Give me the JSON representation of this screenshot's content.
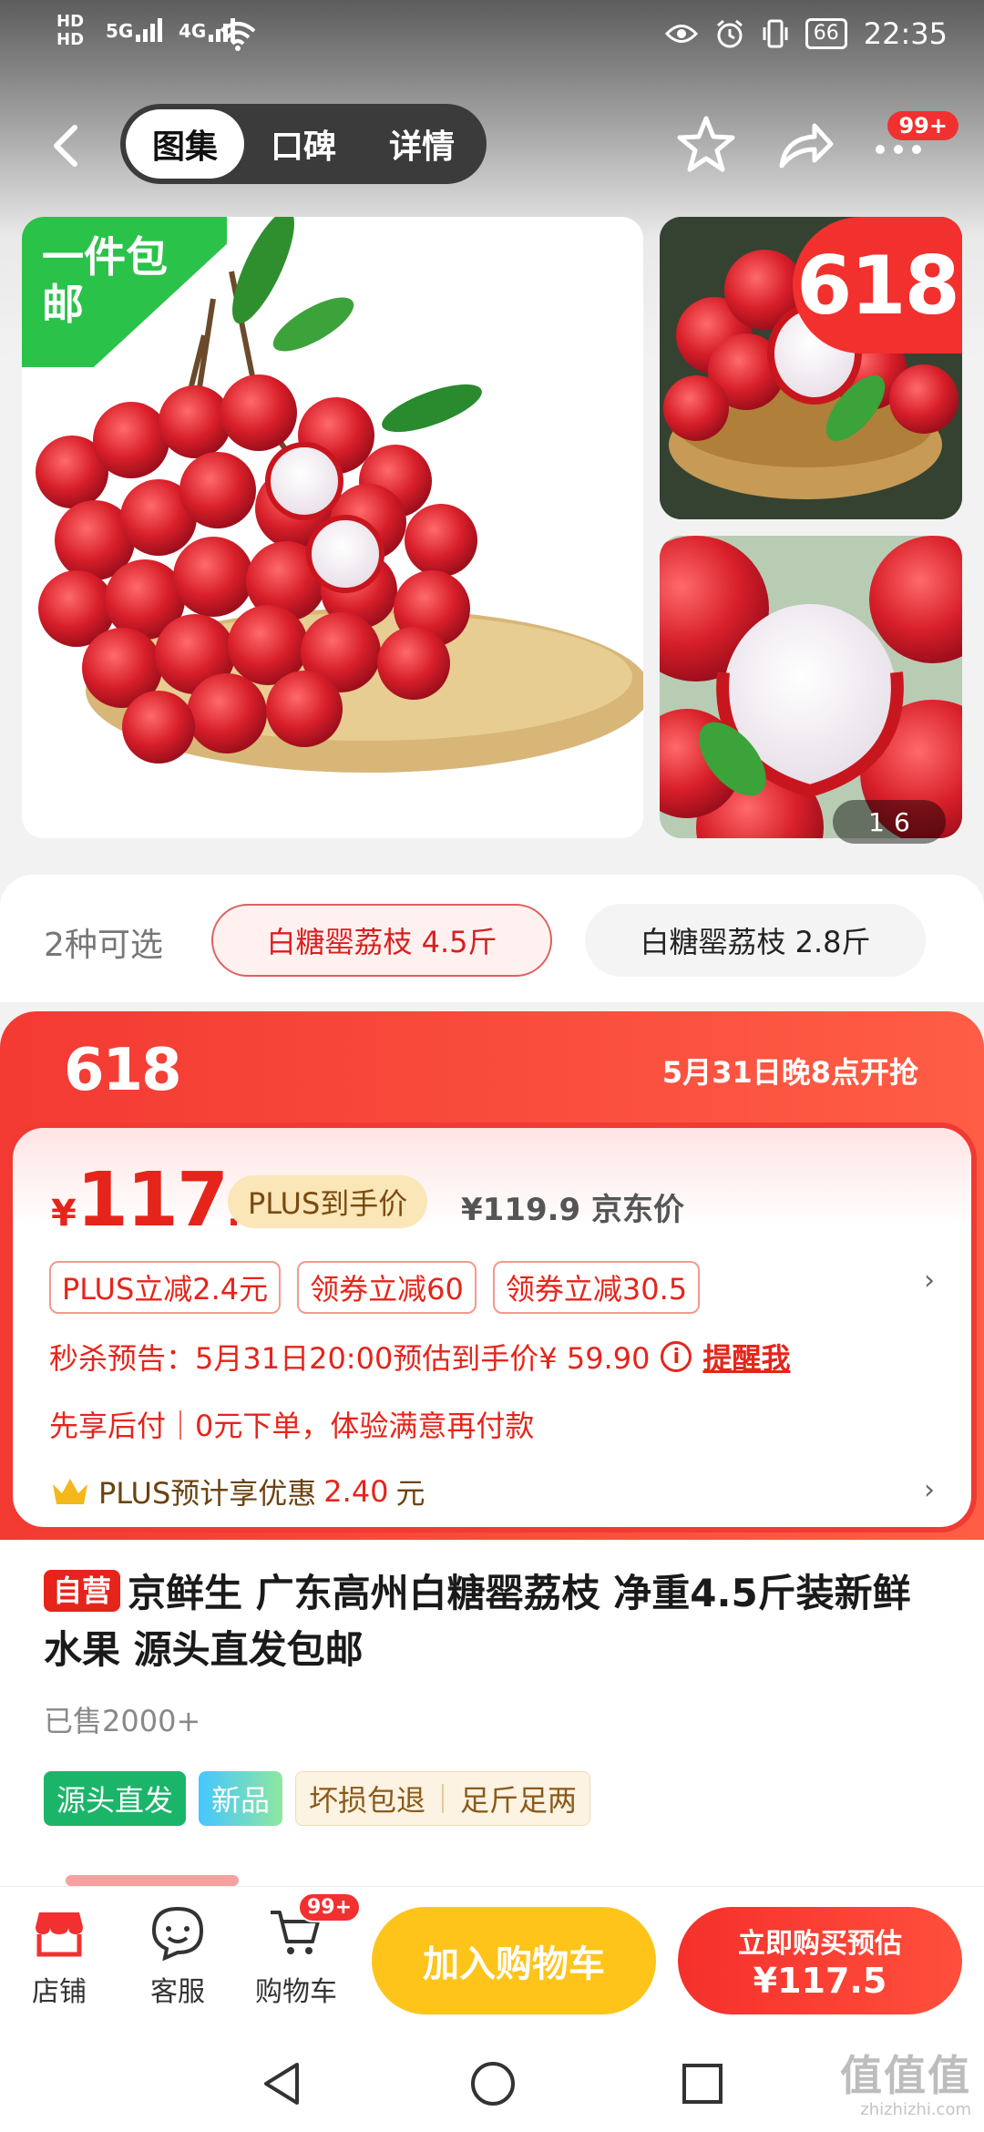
{
  "status_bar": {
    "hd1": "HD",
    "hd2": "HD",
    "net1": "5G",
    "net2": "4G",
    "battery": "66",
    "time": "22:35"
  },
  "nav": {
    "tabs": [
      "图集",
      "口碑",
      "详情"
    ],
    "more_badge": "99+"
  },
  "gallery": {
    "shipping_tag": "一件包邮",
    "badge_618": "618",
    "pager_current": "1",
    "pager_total": "6"
  },
  "variants": {
    "count_label": "2种可选",
    "options": [
      "白糖罂荔枝 4.5斤",
      "白糖罂荔枝 2.8斤"
    ]
  },
  "promo": {
    "label_618": "618",
    "start_time": "5月31日晚8点开抢",
    "price_currency": "¥",
    "price_int": "117",
    "price_dec": ".5",
    "plus_tag": "PLUS到手价",
    "jd_price": "¥119.9 京东价",
    "coupons": [
      "PLUS立减2.4元",
      "领券立减60",
      "领券立减30.5"
    ],
    "seckill_text": "秒杀预告：5月31日20:00预估到手价¥ 59.90",
    "info_glyph": "i",
    "remind": "提醒我",
    "paylater": "先享后付｜0元下单，体验满意再付款",
    "plus_row_prefix": "PLUS预计享优惠",
    "plus_row_amount": "2.40",
    "plus_row_suffix": "元",
    "chevron": "›"
  },
  "product": {
    "self_operated": "自营",
    "title": "京鲜生 广东高州白糖罂荔枝 净重4.5斤装新鲜水果 源头直发包邮",
    "sold": "已售2000+",
    "tag_direct": "源头直发",
    "tag_new": "新品",
    "tag_refund": "坏损包退",
    "tag_weight": "足斤足两"
  },
  "action_bar": {
    "shop": "店铺",
    "service": "客服",
    "cart": "购物车",
    "cart_badge": "99+",
    "add_to_cart": "加入购物车",
    "buy_line1": "立即购买预估",
    "buy_line2": "¥117.5"
  },
  "watermark": {
    "main": "值值值",
    "sub": "zhizhizhi.com"
  },
  "colors": {
    "jd_red": "#e5251b",
    "plus_gold": "#fbe6b8",
    "cart_yellow": "#ffc41a",
    "green": "#2bc24a"
  },
  "icons": [
    "back-icon",
    "star-icon",
    "share-icon",
    "more-icon",
    "crown-icon",
    "shop-icon",
    "service-icon",
    "cart-icon"
  ]
}
